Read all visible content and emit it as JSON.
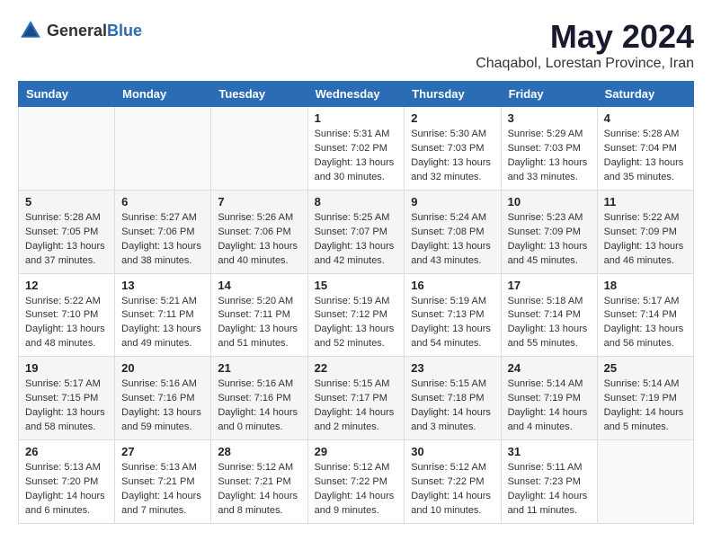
{
  "logo": {
    "text_general": "General",
    "text_blue": "Blue"
  },
  "title": "May 2024",
  "subtitle": "Chaqabol, Lorestan Province, Iran",
  "days_of_week": [
    "Sunday",
    "Monday",
    "Tuesday",
    "Wednesday",
    "Thursday",
    "Friday",
    "Saturday"
  ],
  "weeks": [
    [
      {
        "day": "",
        "sunrise": "",
        "sunset": "",
        "daylight": ""
      },
      {
        "day": "",
        "sunrise": "",
        "sunset": "",
        "daylight": ""
      },
      {
        "day": "",
        "sunrise": "",
        "sunset": "",
        "daylight": ""
      },
      {
        "day": "1",
        "sunrise": "Sunrise: 5:31 AM",
        "sunset": "Sunset: 7:02 PM",
        "daylight": "Daylight: 13 hours and 30 minutes."
      },
      {
        "day": "2",
        "sunrise": "Sunrise: 5:30 AM",
        "sunset": "Sunset: 7:03 PM",
        "daylight": "Daylight: 13 hours and 32 minutes."
      },
      {
        "day": "3",
        "sunrise": "Sunrise: 5:29 AM",
        "sunset": "Sunset: 7:03 PM",
        "daylight": "Daylight: 13 hours and 33 minutes."
      },
      {
        "day": "4",
        "sunrise": "Sunrise: 5:28 AM",
        "sunset": "Sunset: 7:04 PM",
        "daylight": "Daylight: 13 hours and 35 minutes."
      }
    ],
    [
      {
        "day": "5",
        "sunrise": "Sunrise: 5:28 AM",
        "sunset": "Sunset: 7:05 PM",
        "daylight": "Daylight: 13 hours and 37 minutes."
      },
      {
        "day": "6",
        "sunrise": "Sunrise: 5:27 AM",
        "sunset": "Sunset: 7:06 PM",
        "daylight": "Daylight: 13 hours and 38 minutes."
      },
      {
        "day": "7",
        "sunrise": "Sunrise: 5:26 AM",
        "sunset": "Sunset: 7:06 PM",
        "daylight": "Daylight: 13 hours and 40 minutes."
      },
      {
        "day": "8",
        "sunrise": "Sunrise: 5:25 AM",
        "sunset": "Sunset: 7:07 PM",
        "daylight": "Daylight: 13 hours and 42 minutes."
      },
      {
        "day": "9",
        "sunrise": "Sunrise: 5:24 AM",
        "sunset": "Sunset: 7:08 PM",
        "daylight": "Daylight: 13 hours and 43 minutes."
      },
      {
        "day": "10",
        "sunrise": "Sunrise: 5:23 AM",
        "sunset": "Sunset: 7:09 PM",
        "daylight": "Daylight: 13 hours and 45 minutes."
      },
      {
        "day": "11",
        "sunrise": "Sunrise: 5:22 AM",
        "sunset": "Sunset: 7:09 PM",
        "daylight": "Daylight: 13 hours and 46 minutes."
      }
    ],
    [
      {
        "day": "12",
        "sunrise": "Sunrise: 5:22 AM",
        "sunset": "Sunset: 7:10 PM",
        "daylight": "Daylight: 13 hours and 48 minutes."
      },
      {
        "day": "13",
        "sunrise": "Sunrise: 5:21 AM",
        "sunset": "Sunset: 7:11 PM",
        "daylight": "Daylight: 13 hours and 49 minutes."
      },
      {
        "day": "14",
        "sunrise": "Sunrise: 5:20 AM",
        "sunset": "Sunset: 7:11 PM",
        "daylight": "Daylight: 13 hours and 51 minutes."
      },
      {
        "day": "15",
        "sunrise": "Sunrise: 5:19 AM",
        "sunset": "Sunset: 7:12 PM",
        "daylight": "Daylight: 13 hours and 52 minutes."
      },
      {
        "day": "16",
        "sunrise": "Sunrise: 5:19 AM",
        "sunset": "Sunset: 7:13 PM",
        "daylight": "Daylight: 13 hours and 54 minutes."
      },
      {
        "day": "17",
        "sunrise": "Sunrise: 5:18 AM",
        "sunset": "Sunset: 7:14 PM",
        "daylight": "Daylight: 13 hours and 55 minutes."
      },
      {
        "day": "18",
        "sunrise": "Sunrise: 5:17 AM",
        "sunset": "Sunset: 7:14 PM",
        "daylight": "Daylight: 13 hours and 56 minutes."
      }
    ],
    [
      {
        "day": "19",
        "sunrise": "Sunrise: 5:17 AM",
        "sunset": "Sunset: 7:15 PM",
        "daylight": "Daylight: 13 hours and 58 minutes."
      },
      {
        "day": "20",
        "sunrise": "Sunrise: 5:16 AM",
        "sunset": "Sunset: 7:16 PM",
        "daylight": "Daylight: 13 hours and 59 minutes."
      },
      {
        "day": "21",
        "sunrise": "Sunrise: 5:16 AM",
        "sunset": "Sunset: 7:16 PM",
        "daylight": "Daylight: 14 hours and 0 minutes."
      },
      {
        "day": "22",
        "sunrise": "Sunrise: 5:15 AM",
        "sunset": "Sunset: 7:17 PM",
        "daylight": "Daylight: 14 hours and 2 minutes."
      },
      {
        "day": "23",
        "sunrise": "Sunrise: 5:15 AM",
        "sunset": "Sunset: 7:18 PM",
        "daylight": "Daylight: 14 hours and 3 minutes."
      },
      {
        "day": "24",
        "sunrise": "Sunrise: 5:14 AM",
        "sunset": "Sunset: 7:19 PM",
        "daylight": "Daylight: 14 hours and 4 minutes."
      },
      {
        "day": "25",
        "sunrise": "Sunrise: 5:14 AM",
        "sunset": "Sunset: 7:19 PM",
        "daylight": "Daylight: 14 hours and 5 minutes."
      }
    ],
    [
      {
        "day": "26",
        "sunrise": "Sunrise: 5:13 AM",
        "sunset": "Sunset: 7:20 PM",
        "daylight": "Daylight: 14 hours and 6 minutes."
      },
      {
        "day": "27",
        "sunrise": "Sunrise: 5:13 AM",
        "sunset": "Sunset: 7:21 PM",
        "daylight": "Daylight: 14 hours and 7 minutes."
      },
      {
        "day": "28",
        "sunrise": "Sunrise: 5:12 AM",
        "sunset": "Sunset: 7:21 PM",
        "daylight": "Daylight: 14 hours and 8 minutes."
      },
      {
        "day": "29",
        "sunrise": "Sunrise: 5:12 AM",
        "sunset": "Sunset: 7:22 PM",
        "daylight": "Daylight: 14 hours and 9 minutes."
      },
      {
        "day": "30",
        "sunrise": "Sunrise: 5:12 AM",
        "sunset": "Sunset: 7:22 PM",
        "daylight": "Daylight: 14 hours and 10 minutes."
      },
      {
        "day": "31",
        "sunrise": "Sunrise: 5:11 AM",
        "sunset": "Sunset: 7:23 PM",
        "daylight": "Daylight: 14 hours and 11 minutes."
      },
      {
        "day": "",
        "sunrise": "",
        "sunset": "",
        "daylight": ""
      }
    ]
  ]
}
